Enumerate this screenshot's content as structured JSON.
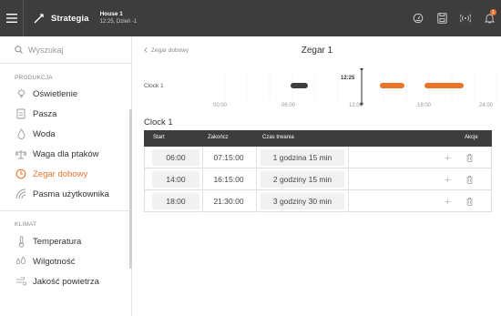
{
  "topbar": {
    "brand": "Strategia",
    "house_name": "House 1",
    "house_time": "12:25, Dzień -1",
    "alarm_count": "1"
  },
  "sidebar": {
    "search_placeholder": "Wyszukaj",
    "section_production": "PRODUKCJA",
    "section_climate": "KLIMAT",
    "items": [
      {
        "label": "Oświetlenie",
        "icon": "bulb-icon"
      },
      {
        "label": "Pasza",
        "icon": "feed-icon"
      },
      {
        "label": "Woda",
        "icon": "water-drop-icon"
      },
      {
        "label": "Waga dla ptaków",
        "icon": "scale-icon"
      },
      {
        "label": "Zegar dobowy",
        "icon": "clock-icon",
        "active": true
      },
      {
        "label": "Pasma użytkownika",
        "icon": "user-band-icon"
      }
    ],
    "climate_items": [
      {
        "label": "Temperatura",
        "icon": "thermometer-icon"
      },
      {
        "label": "Wilgotność",
        "icon": "humidity-icon"
      },
      {
        "label": "Jakość powietrza",
        "icon": "air-quality-icon"
      }
    ]
  },
  "main": {
    "back_label": "Zegar dobowy",
    "title": "Zegar 1",
    "timeline": {
      "label": "Clock 1",
      "now": "12:25",
      "ticks": [
        "00:00",
        "06:00",
        "12:00",
        "18:00",
        "24:00"
      ]
    },
    "clock_title": "Clock 1",
    "table": {
      "headers": {
        "start": "Start",
        "end": "Zakończ",
        "duration": "Czas trwania",
        "actions": "Akcje"
      },
      "rows": [
        {
          "start": "06:00",
          "end": "07:15:00",
          "duration": "1 godzina 15 min"
        },
        {
          "start": "14:00",
          "end": "16:15:00",
          "duration": "2 godziny 15 min"
        },
        {
          "start": "18:00",
          "end": "21:30:00",
          "duration": "3 godziny 30 min"
        }
      ]
    }
  },
  "colors": {
    "accent": "#e9732b",
    "topbar": "#3d3d3d",
    "passed_bar": "#3d3d3d"
  }
}
